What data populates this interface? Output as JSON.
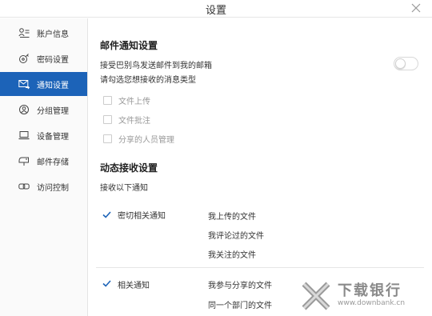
{
  "window": {
    "title": "设置"
  },
  "sidebar": {
    "items": [
      {
        "label": "账户信息",
        "icon": "account-icon"
      },
      {
        "label": "密码设置",
        "icon": "lock-icon"
      },
      {
        "label": "通知设置",
        "icon": "mail-notify-icon",
        "active": true
      },
      {
        "label": "分组管理",
        "icon": "group-icon"
      },
      {
        "label": "设备管理",
        "icon": "laptop-icon"
      },
      {
        "label": "邮件存储",
        "icon": "mailbox-icon"
      },
      {
        "label": "访问控制",
        "icon": "link-icon"
      }
    ]
  },
  "email": {
    "title": "邮件通知设置",
    "receive_label": "接受巴别鸟发送邮件到我的邮箱",
    "receive_enabled": false,
    "type_prompt": "请勾选您想接收的消息类型",
    "types": [
      {
        "label": "文件上传",
        "checked": false
      },
      {
        "label": "文件批注",
        "checked": false
      },
      {
        "label": "分享的人员管理",
        "checked": false
      }
    ]
  },
  "dynamic": {
    "title": "动态接收设置",
    "prompt": "接收以下通知",
    "groups": [
      {
        "label": "密切相关通知",
        "checked": true,
        "items": [
          "我上传的文件",
          "我评论过的文件",
          "我关注的文件"
        ]
      },
      {
        "label": "相关通知",
        "checked": true,
        "items": [
          "我参与分享的文件",
          "同一个部门的文件"
        ]
      }
    ]
  },
  "watermark": {
    "text": "下载银行",
    "url": "www.downbank.cn"
  },
  "colors": {
    "accent": "#1c63b8",
    "check": "#1c63b8"
  }
}
